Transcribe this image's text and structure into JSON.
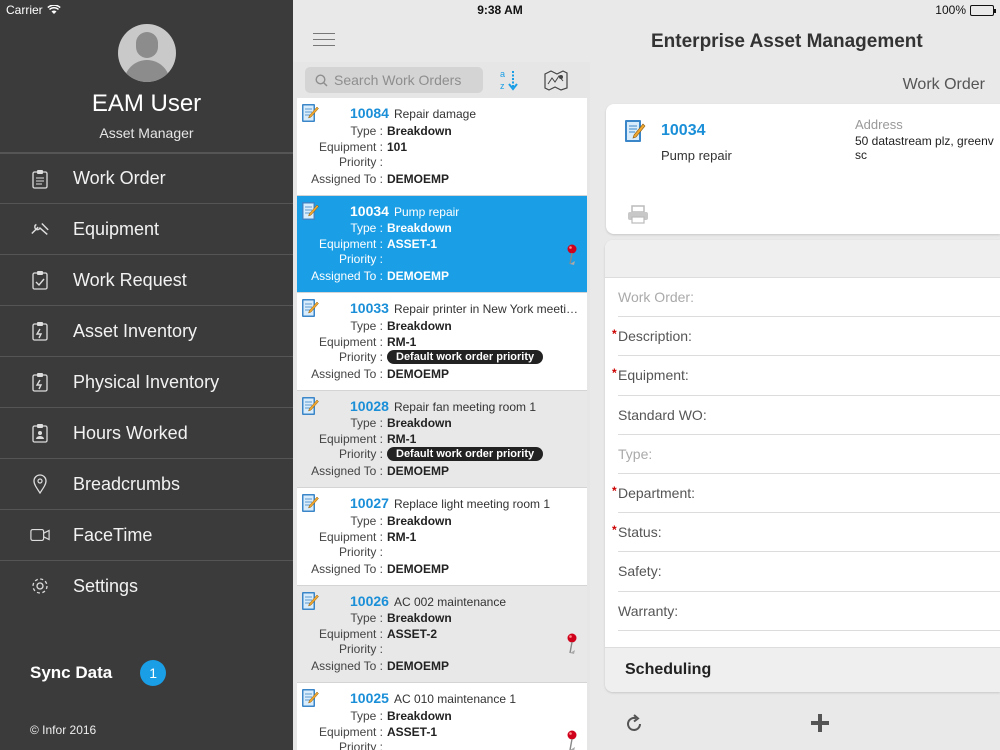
{
  "status_bar": {
    "carrier": "Carrier",
    "time": "9:38 AM",
    "battery": "100%",
    "battery_level": 1.0
  },
  "sidebar": {
    "user_name": "EAM User",
    "user_role": "Asset Manager",
    "menu": [
      {
        "label": "Work Order",
        "icon": "clipboard-icon"
      },
      {
        "label": "Equipment",
        "icon": "wrench-icon"
      },
      {
        "label": "Work Request",
        "icon": "clipboard-check-icon"
      },
      {
        "label": "Asset Inventory",
        "icon": "clipboard-scan-icon"
      },
      {
        "label": "Physical Inventory",
        "icon": "clipboard-scan-icon"
      },
      {
        "label": "Hours Worked",
        "icon": "clipboard-person-icon"
      },
      {
        "label": "Breadcrumbs",
        "icon": "location-pin-icon"
      },
      {
        "label": "FaceTime",
        "icon": "video-camera-icon"
      },
      {
        "label": "Settings",
        "icon": "gear-icon"
      }
    ],
    "sync_label": "Sync Data",
    "sync_count": "1",
    "copyright": "© Infor 2016"
  },
  "header": {
    "title": "Enterprise Asset Management"
  },
  "list": {
    "search_placeholder": "Search Work Orders",
    "labels": {
      "type": "Type :",
      "equipment": "Equipment :",
      "priority": "Priority :",
      "assigned": "Assigned To :"
    },
    "items": [
      {
        "number": "10084",
        "title": "Repair damage",
        "type": "Breakdown",
        "equipment": "101",
        "priority": "",
        "assigned": "DEMOEMP",
        "pinned": false
      },
      {
        "number": "10034",
        "title": "Pump repair",
        "type": "Breakdown",
        "equipment": "ASSET-1",
        "priority": "",
        "assigned": "DEMOEMP",
        "pinned": true
      },
      {
        "number": "10033",
        "title": "Repair printer in New York meetin...",
        "type": "Breakdown",
        "equipment": "RM-1",
        "priority": "Default work order priority",
        "assigned": "DEMOEMP",
        "pinned": false
      },
      {
        "number": "10028",
        "title": "Repair fan meeting room 1",
        "type": "Breakdown",
        "equipment": "RM-1",
        "priority": "Default work order priority",
        "assigned": "DEMOEMP",
        "pinned": false
      },
      {
        "number": "10027",
        "title": "Replace light meeting room 1",
        "type": "Breakdown",
        "equipment": "RM-1",
        "priority": "",
        "assigned": "DEMOEMP",
        "pinned": false
      },
      {
        "number": "10026",
        "title": "AC 002 maintenance",
        "type": "Breakdown",
        "equipment": "ASSET-2",
        "priority": "",
        "assigned": "DEMOEMP",
        "pinned": true
      },
      {
        "number": "10025",
        "title": "AC 010 maintenance  1",
        "type": "Breakdown",
        "equipment": "ASSET-1",
        "priority": "",
        "assigned": "",
        "pinned": true
      }
    ]
  },
  "detail": {
    "title": "Work Order",
    "summary": {
      "number": "10034",
      "description": "Pump repair",
      "address_label": "Address",
      "address_line1": "50 datastream plz, greenv",
      "address_line2": "sc"
    },
    "fields": [
      {
        "label": "Work Order:",
        "required": false,
        "muted": true
      },
      {
        "label": "Description:",
        "required": true,
        "muted": false
      },
      {
        "label": "Equipment:",
        "required": true,
        "muted": false
      },
      {
        "label": "Standard WO:",
        "required": false,
        "muted": false
      },
      {
        "label": "Type:",
        "required": false,
        "muted": true
      },
      {
        "label": "Department:",
        "required": true,
        "muted": false
      },
      {
        "label": "Status:",
        "required": true,
        "muted": false
      },
      {
        "label": "Safety:",
        "required": false,
        "muted": false
      },
      {
        "label": "Warranty:",
        "required": false,
        "muted": false
      }
    ],
    "scheduling_label": "Scheduling"
  },
  "colors": {
    "accent": "#1a9ee6",
    "sidebar": "#3b3b3b",
    "required": "#cc0000"
  }
}
